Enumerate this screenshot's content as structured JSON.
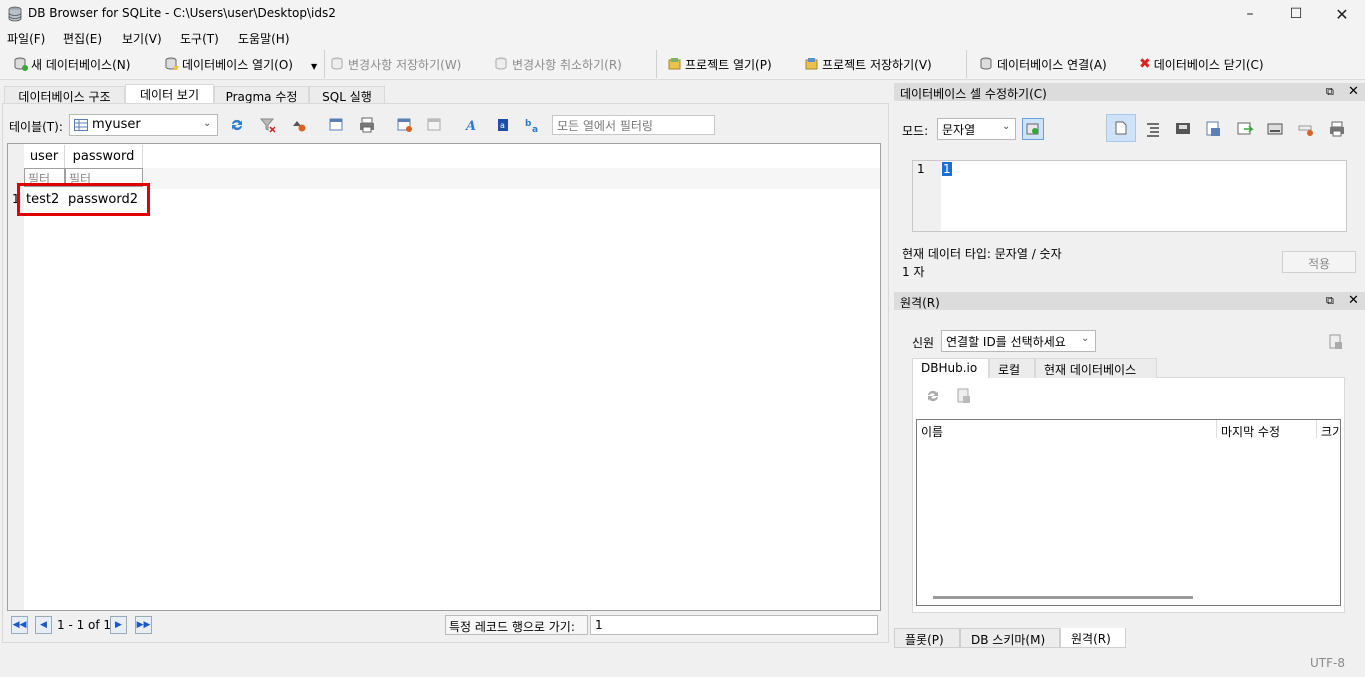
{
  "window": {
    "title": "DB Browser for SQLite - C:\\Users\\user\\Desktop\\ids2"
  },
  "menu": [
    "파일(F)",
    "편집(E)",
    "보기(V)",
    "도구(T)",
    "도움말(H)"
  ],
  "toolbar": {
    "new_db": "새 데이터베이스(N)",
    "open_db": "데이터베이스 열기(O)",
    "write_changes": "변경사항 저장하기(W)",
    "revert_changes": "변경사항 취소하기(R)",
    "open_project": "프로젝트 열기(P)",
    "save_project": "프로젝트 저장하기(V)",
    "attach_db": "데이터베이스 연결(A)",
    "close_db": "데이터베이스 닫기(C)"
  },
  "main_tabs": [
    "데이터베이스 구조",
    "데이터 보기",
    "Pragma 수정",
    "SQL 실행"
  ],
  "browse": {
    "table_label": "테이블(T):",
    "table_value": "myuser",
    "filter_all_placeholder": "모든 열에서 필터링",
    "columns": [
      "user",
      "password"
    ],
    "filter_placeholder": "필터",
    "rows": [
      {
        "num": "1",
        "user": "test2",
        "password": "password2"
      }
    ],
    "record_info": "1 - 1 of 1",
    "goto_label": "특정 레코드 행으로 가기:",
    "goto_value": "1"
  },
  "edit_cell": {
    "title": "데이터베이스 셀 수정하기(C)",
    "mode_label": "모드:",
    "mode_value": "문자열",
    "line_number": "1",
    "editor_value": "1",
    "type_info": "현재 데이터 타입: 문자열 / 숫자",
    "size_info": "1 자",
    "apply": "적용"
  },
  "remote": {
    "title": "원격(R)",
    "identity_label": "신원",
    "identity_value": "연결할 ID를 선택하세요",
    "tabs": [
      "DBHub.io",
      "로컬",
      "현재 데이터베이스"
    ],
    "columns": [
      "이름",
      "마지막 수정",
      "크기"
    ]
  },
  "bottom_tabs": [
    "플롯(P)",
    "DB 스키마(M)",
    "원격(R)"
  ],
  "status": {
    "encoding": "UTF-8"
  }
}
